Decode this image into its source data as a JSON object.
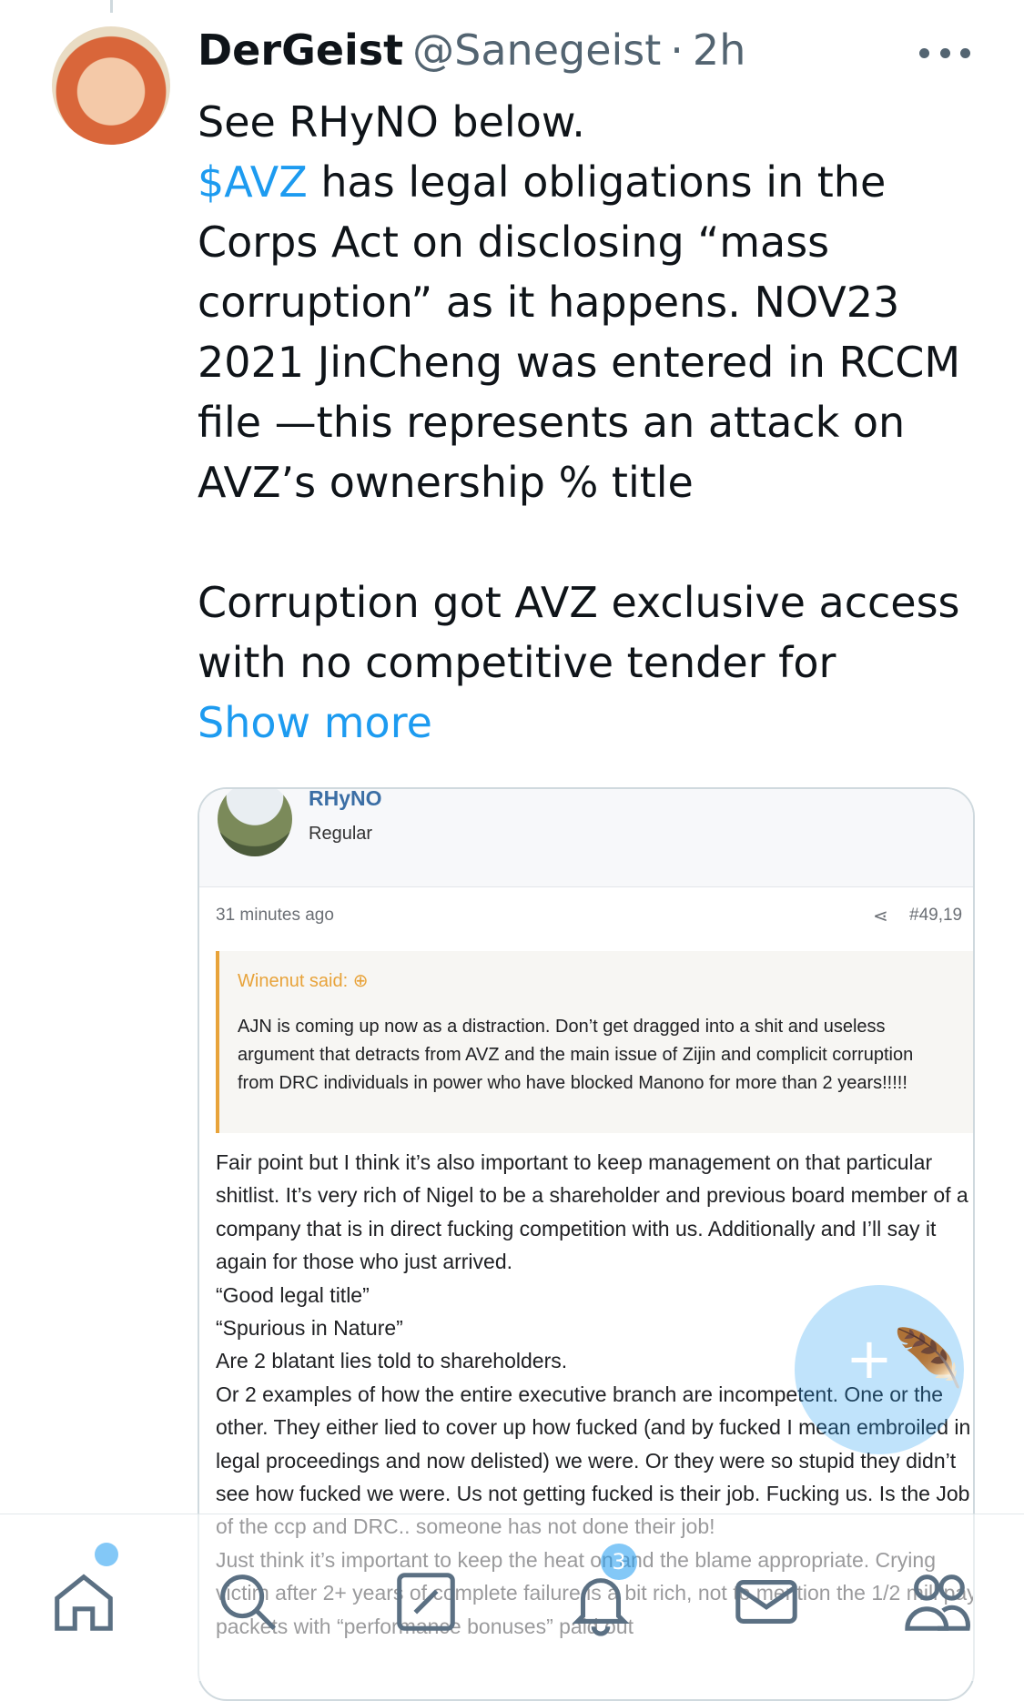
{
  "tweet": {
    "display_name": "DerGeist",
    "handle": "@Sanegeist",
    "separator": "·",
    "time": "2h",
    "line1": "See RHyNO below.",
    "cashtag": "$AVZ",
    "para1_rest": " has legal obligations in the Corps Act on disclosing “mass corruption” as it happens. NOV23 2021 JinCheng was entered in RCCM file —this represents an attack on AVZ’s ownership % title",
    "para2": "Corruption got AVZ exclusive access with no competitive tender for",
    "show_more": "Show more"
  },
  "forum_post": {
    "username": "RHyNO",
    "role": "Regular",
    "time_ago": "31 minutes ago",
    "post_number": "#49,19",
    "quote_author": "Winenut said: ⊕",
    "quote_text": "AJN is coming up now as a distraction. Don’t get dragged into a shit and useless argument that detracts from AVZ and the main issue of Zijin and complicit corruption from DRC individuals in power who have blocked Manono for more than 2 years!!!!!",
    "reply_text": "Fair point but I think it’s also important to keep management on that particular shitlist. It’s very rich of Nigel to be a shareholder and previous board member of a company that is in direct fucking competition with us. Additionally and I’ll say it again for those who just arrived.\n“Good legal title”\n“Spurious in Nature”\nAre 2 blatant lies told to shareholders.\nOr 2 examples of how the entire executive branch are incompetent. One or the other. They either lied to cover up how fucked (and by fucked I mean embroiled in legal proceedings and now delisted) we were. Or they were so stupid they didn’t see how fucked we were. Us not getting fucked is their job. Fucking us. Is the Job of the ccp and DRC.. someone has not done their job!\nJust think it’s important to keep the heat on and the blame appropriate. Crying victim after 2+ years of complete failure is a bit rich, not to mention the 1/2 mill pay packets with “performance bonuses” paid out"
  },
  "compose_fab": {
    "icon": "+🪶"
  },
  "tab_bar": {
    "notification_count": "3",
    "icons": [
      "home-icon",
      "search-icon",
      "communities-icon",
      "notifications-icon",
      "messages-icon",
      "people-icon"
    ]
  },
  "colors": {
    "accent": "#1d9bf0",
    "quote_bar": "#e8a33a",
    "forum_link": "#3b6ea5"
  }
}
